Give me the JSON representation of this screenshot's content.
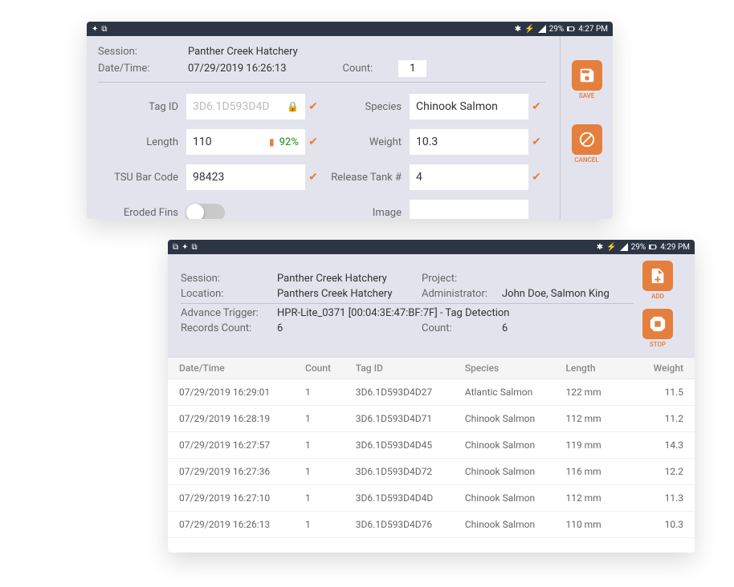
{
  "statusbar1": {
    "battery": "29%",
    "time": "4:27 PM"
  },
  "statusbar2": {
    "battery": "29%",
    "time": "4:29 PM"
  },
  "form": {
    "session_label": "Session:",
    "session_value": "Panther Creek Hatchery",
    "datetime_label": "Date/Time:",
    "datetime_value": "07/29/2019 16:26:13",
    "count_label": "Count:",
    "count_value": "1",
    "fields": {
      "tag_id_label": "Tag ID",
      "tag_id_value": "3D6.1D593D4D",
      "species_label": "Species",
      "species_value": "Chinook Salmon",
      "length_label": "Length",
      "length_value": "110",
      "length_pct": "92%",
      "weight_label": "Weight",
      "weight_value": "10.3",
      "tsu_label": "TSU Bar Code",
      "tsu_value": "98423",
      "release_label": "Release Tank #",
      "release_value": "4",
      "eroded_label": "Eroded Fins",
      "image_label": "Image"
    },
    "save_label": "SAVE",
    "cancel_label": "CANCEL"
  },
  "list": {
    "session_label": "Session:",
    "session_value": "Panther Creek Hatchery",
    "project_label": "Project:",
    "location_label": "Location:",
    "location_value": "Panthers Creek Hatchery",
    "admin_label": "Administrator:",
    "admin_value": "John  Doe, Salmon King",
    "trigger_label": "Advance Trigger:",
    "trigger_value": "HPR-Lite_0371 [00:04:3E:47:BF:7F] - Tag Detection",
    "records_label": "Records Count:",
    "records_value": "6",
    "count_label": "Count:",
    "count_value": "6",
    "add_label": "ADD",
    "stop_label": "STOP",
    "columns": {
      "dt": "Date/Time",
      "count": "Count",
      "tag": "Tag ID",
      "species": "Species",
      "length": "Length",
      "weight": "Weight"
    },
    "rows": [
      {
        "dt": "07/29/2019 16:29:01",
        "count": "1",
        "tag": "3D6.1D593D4D27",
        "species": "Atlantic Salmon",
        "length": "122 mm",
        "weight": "11.5"
      },
      {
        "dt": "07/29/2019 16:28:19",
        "count": "1",
        "tag": "3D6.1D593D4D71",
        "species": "Chinook Salmon",
        "length": "112 mm",
        "weight": "11.2"
      },
      {
        "dt": "07/29/2019 16:27:57",
        "count": "1",
        "tag": "3D6.1D593D4D45",
        "species": "Chinook Salmon",
        "length": "119 mm",
        "weight": "14.3"
      },
      {
        "dt": "07/29/2019 16:27:36",
        "count": "1",
        "tag": "3D6.1D593D4D72",
        "species": "Chinook Salmon",
        "length": "116 mm",
        "weight": "12.2"
      },
      {
        "dt": "07/29/2019 16:27:10",
        "count": "1",
        "tag": "3D6.1D593D4D4D",
        "species": "Chinook Salmon",
        "length": "112 mm",
        "weight": "11.3"
      },
      {
        "dt": "07/29/2019 16:26:13",
        "count": "1",
        "tag": "3D6.1D593D4D76",
        "species": "Chinook Salmon",
        "length": "110 mm",
        "weight": "10.3"
      }
    ]
  }
}
